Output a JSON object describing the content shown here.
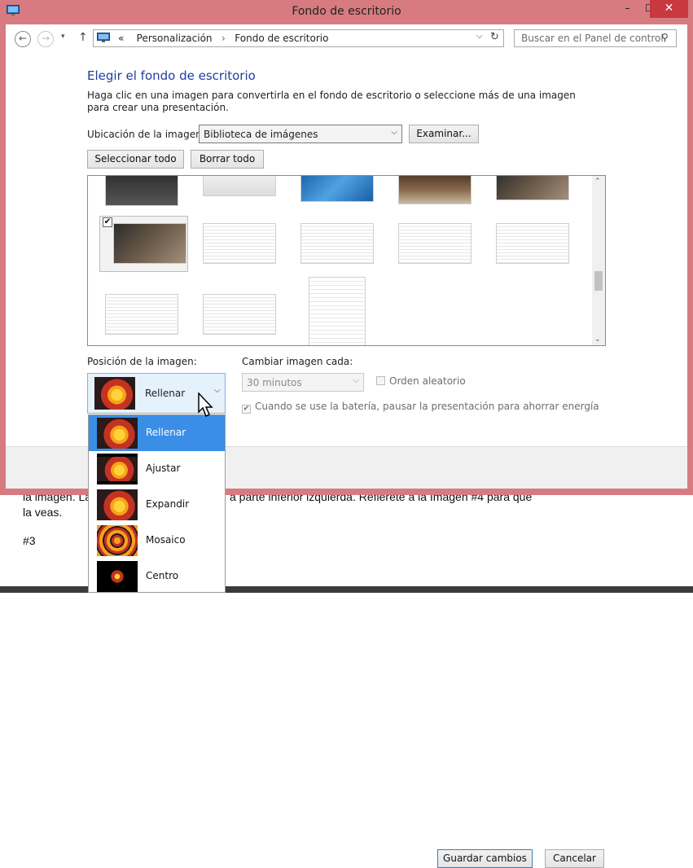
{
  "window": {
    "title": "Fondo de escritorio",
    "controls": {
      "minimize": "–",
      "maximize": "☐",
      "close": "✕"
    }
  },
  "address_bar": {
    "back": "←",
    "forward": "→",
    "history_dropdown": "▾",
    "up": "↑",
    "crumb_prefix": "«",
    "crumbs": [
      "Personalización",
      "Fondo de escritorio"
    ],
    "separator": "›",
    "dropdown": "⌵",
    "refresh": "↻",
    "search_placeholder": "Buscar en el Panel de control",
    "search_icon": "⚲"
  },
  "main": {
    "heading": "Elegir el fondo de escritorio",
    "description": "Haga clic en una imagen para convertirla en el fondo de escritorio o seleccione más de una imagen para crear una presentación.",
    "location_label": "Ubicación de la imagen:",
    "location_value": "Biblioteca de imágenes",
    "browse_button": "Examinar...",
    "select_all_button": "Seleccionar todo",
    "clear_all_button": "Borrar todo",
    "checked_mark": "✔",
    "scroll_up": "⌃",
    "scroll_down": "⌄"
  },
  "options": {
    "position_label": "Posición de la imagen:",
    "position_value": "Rellenar",
    "change_label": "Cambiar imagen cada:",
    "interval_value": "30 minutos",
    "random_label": "Orden aleatorio",
    "random_checked": false,
    "battery_label": "Cuando se use la batería, pausar la presentación para ahorrar energía",
    "battery_checked": true
  },
  "position_dropdown": {
    "items": [
      {
        "label": "Rellenar",
        "icon": "fill-preview-icon",
        "selected": true
      },
      {
        "label": "Ajustar",
        "icon": "fit-preview-icon",
        "selected": false
      },
      {
        "label": "Expandir",
        "icon": "stretch-preview-icon",
        "selected": false
      },
      {
        "label": "Mosaico",
        "icon": "tile-preview-icon",
        "selected": false
      },
      {
        "label": "Centro",
        "icon": "center-preview-icon",
        "selected": false
      }
    ]
  },
  "footer": {
    "save_button": "Guardar cambios",
    "cancel_button": "Cancelar"
  },
  "background_document": {
    "line1": "la imagen. La",
    "line1_right": "a parte inferior izquierda. Refiérete a la Imagen #4 para que",
    "line2": "la veas.",
    "line3": "#3"
  },
  "colors": {
    "title_bar": "#d77b80",
    "close_button": "#c7383f",
    "heading": "#1e3e9e",
    "selected_item": "#3a8ee6"
  }
}
